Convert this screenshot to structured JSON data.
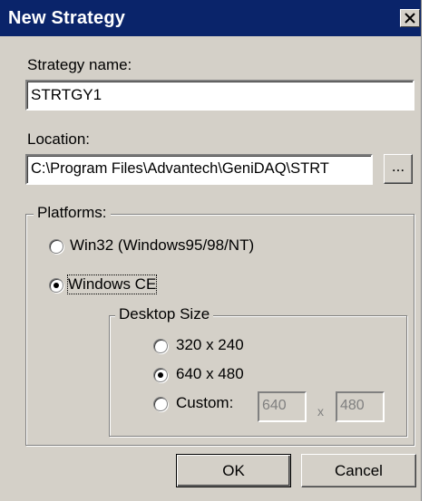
{
  "window": {
    "title": "New Strategy"
  },
  "strategy_name": {
    "label": "Strategy name:",
    "value": "STRTGY1"
  },
  "location": {
    "label": "Location:",
    "value": "C:\\Program Files\\Advantech\\GeniDAQ\\STRT",
    "browse_label": "..."
  },
  "platforms": {
    "title": "Platforms:",
    "options": [
      {
        "label": "Win32 (Windows95/98/NT)",
        "selected": false
      },
      {
        "label": "Windows CE",
        "selected": true
      }
    ]
  },
  "desktop_size": {
    "title": "Desktop Size",
    "options": [
      {
        "label": "320 x 240",
        "selected": false
      },
      {
        "label": "640 x 480",
        "selected": true
      },
      {
        "label": "Custom:",
        "selected": false
      }
    ],
    "custom_width": "640",
    "custom_separator": "x",
    "custom_height": "480"
  },
  "buttons": {
    "ok": "OK",
    "cancel": "Cancel"
  }
}
